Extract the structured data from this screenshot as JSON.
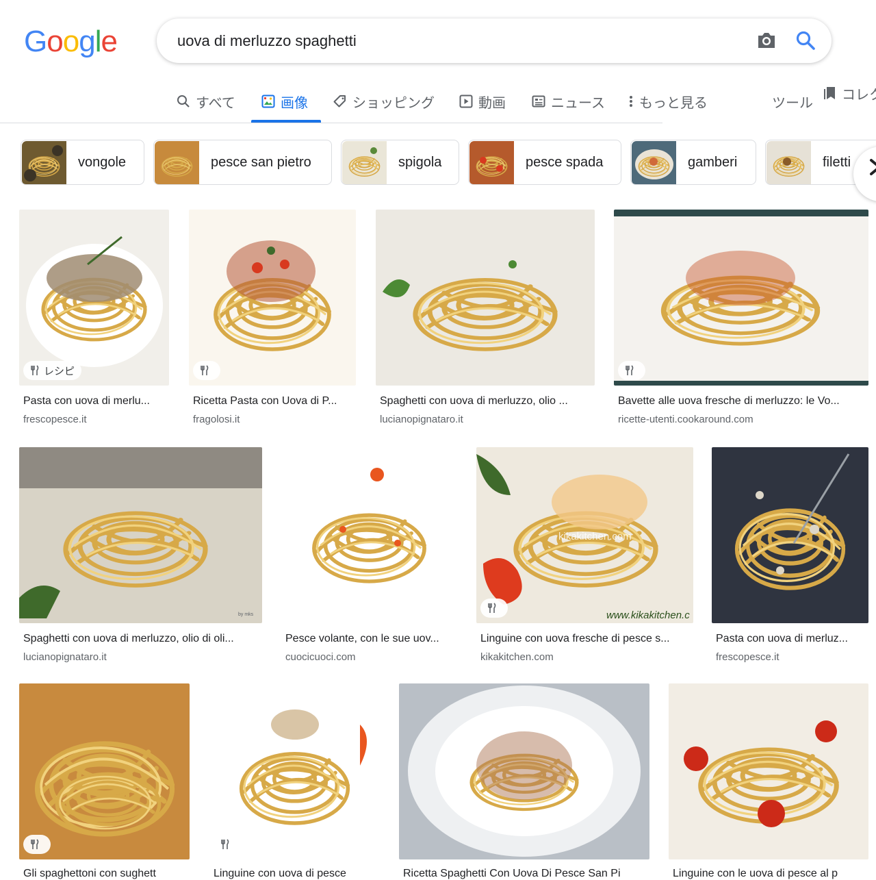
{
  "logo": {
    "letters": [
      "G",
      "o",
      "o",
      "g",
      "l",
      "e"
    ]
  },
  "search": {
    "query": "uova di merluzzo spaghetti",
    "camera_icon": "camera-icon",
    "search_icon": "search-icon"
  },
  "tabs": [
    {
      "label": "すべて",
      "icon": "search-icon",
      "active": false
    },
    {
      "label": "画像",
      "icon": "image-icon",
      "active": true
    },
    {
      "label": "ショッピング",
      "icon": "tag-icon",
      "active": false
    },
    {
      "label": "動画",
      "icon": "play-icon",
      "active": false
    },
    {
      "label": "ニュース",
      "icon": "news-icon",
      "active": false
    },
    {
      "label": "もっと見る",
      "icon": "more-icon",
      "active": false
    },
    {
      "label": "ツール",
      "icon": "",
      "active": false
    },
    {
      "label": "コレク",
      "icon": "bookmark-icon",
      "active": false
    }
  ],
  "chips": [
    {
      "label": "vongole"
    },
    {
      "label": "pesce san pietro"
    },
    {
      "label": "spigola"
    },
    {
      "label": "pesce spada"
    },
    {
      "label": "gamberi"
    },
    {
      "label": "filetti"
    }
  ],
  "results": [
    {
      "title": "Pasta con uova di merlu...",
      "source": "frescopesce.it",
      "badge": "レシピ"
    },
    {
      "title": "Ricetta Pasta con Uova di P...",
      "source": "fragolosi.it",
      "badge": ""
    },
    {
      "title": "Spaghetti con uova di merluzzo, olio ...",
      "source": "lucianopignataro.it",
      "badge": null
    },
    {
      "title": "Bavette alle uova fresche di merluzzo: le Vo...",
      "source": "ricette-utenti.cookaround.com",
      "badge": ""
    },
    {
      "title": "Spaghetti con uova di merluzzo, olio di oli...",
      "source": "lucianopignataro.it",
      "badge": null
    },
    {
      "title": "Pesce volante, con le sue uov...",
      "source": "cuocicuoci.com",
      "badge": null
    },
    {
      "title": "Linguine con uova fresche di pesce s...",
      "source": "kikakitchen.com",
      "badge": ""
    },
    {
      "title": "Pasta con uova di merluz...",
      "source": "frescopesce.it",
      "badge": null
    },
    {
      "title": "Gli spaghettoni con sughett",
      "source": "",
      "badge": ""
    },
    {
      "title": "Linguine con uova di pesce",
      "source": "",
      "badge": ""
    },
    {
      "title": "Ricetta Spaghetti Con Uova Di Pesce San Pi",
      "source": "",
      "badge": null
    },
    {
      "title": "Linguine con le uova di pesce al p",
      "source": "",
      "badge": null
    }
  ],
  "watermarks": [
    "kikakitchen.com",
    "www.kikakitchen.c",
    "by mks"
  ],
  "colors": {
    "accent": "#1a73e8",
    "text": "#202124",
    "secondary": "#5f6368"
  }
}
